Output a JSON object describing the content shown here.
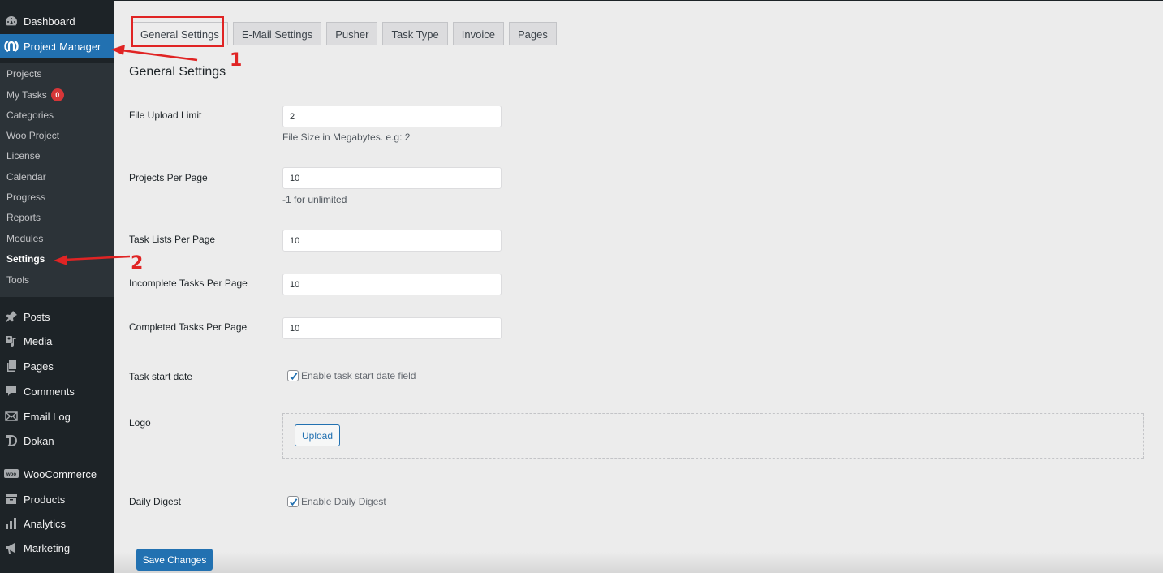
{
  "sidebar": {
    "top_items": [
      {
        "label": "Dashboard",
        "icon": "dashboard-icon"
      },
      {
        "label": "Project Manager",
        "icon": "project-manager-icon",
        "active": true
      }
    ],
    "submenu": [
      {
        "label": "Projects"
      },
      {
        "label": "My Tasks",
        "badge": "0"
      },
      {
        "label": "Categories"
      },
      {
        "label": "Woo Project"
      },
      {
        "label": "License"
      },
      {
        "label": "Calendar"
      },
      {
        "label": "Progress"
      },
      {
        "label": "Reports"
      },
      {
        "label": "Modules"
      },
      {
        "label": "Settings",
        "current": true
      },
      {
        "label": "Tools"
      }
    ],
    "bottom_items": [
      {
        "label": "Posts",
        "icon": "pin-icon"
      },
      {
        "label": "Media",
        "icon": "media-icon"
      },
      {
        "label": "Pages",
        "icon": "pages-icon"
      },
      {
        "label": "Comments",
        "icon": "comment-icon"
      },
      {
        "label": "Email Log",
        "icon": "envelope-icon"
      },
      {
        "label": "Dokan",
        "icon": "dokan-icon"
      },
      {
        "label": "WooCommerce",
        "icon": "woo-icon"
      },
      {
        "label": "Products",
        "icon": "archive-icon"
      },
      {
        "label": "Analytics",
        "icon": "bar-chart-icon"
      },
      {
        "label": "Marketing",
        "icon": "megaphone-icon"
      }
    ]
  },
  "tabs": [
    {
      "label": "General Settings",
      "active": true
    },
    {
      "label": "E-Mail Settings"
    },
    {
      "label": "Pusher"
    },
    {
      "label": "Task Type"
    },
    {
      "label": "Invoice"
    },
    {
      "label": "Pages"
    }
  ],
  "main": {
    "title": "General Settings",
    "fields": {
      "file_upload_limit": {
        "label": "File Upload Limit",
        "value": "2",
        "description": "File Size in Megabytes. e.g: 2"
      },
      "projects_per_page": {
        "label": "Projects Per Page",
        "value": "10",
        "description": "-1 for unlimited"
      },
      "task_lists_per_page": {
        "label": "Task Lists Per Page",
        "value": "10"
      },
      "incomplete_tasks_per_page": {
        "label": "Incomplete Tasks Per Page",
        "value": "10"
      },
      "completed_tasks_per_page": {
        "label": "Completed Tasks Per Page",
        "value": "10"
      },
      "task_start_date": {
        "label": "Task start date",
        "checkbox_label": "Enable task start date field",
        "checked": true
      },
      "logo": {
        "label": "Logo",
        "button_label": "Upload"
      },
      "daily_digest": {
        "label": "Daily Digest",
        "checkbox_label": "Enable Daily Digest",
        "checked": true
      }
    },
    "save_label": "Save Changes"
  },
  "annotations": {
    "step1": "1",
    "step2": "2",
    "color": "#e02424"
  },
  "colors": {
    "sidebar_bg": "#1d2327",
    "submenu_bg": "#2c3338",
    "accent": "#2271b1",
    "page_bg": "#ececec"
  }
}
